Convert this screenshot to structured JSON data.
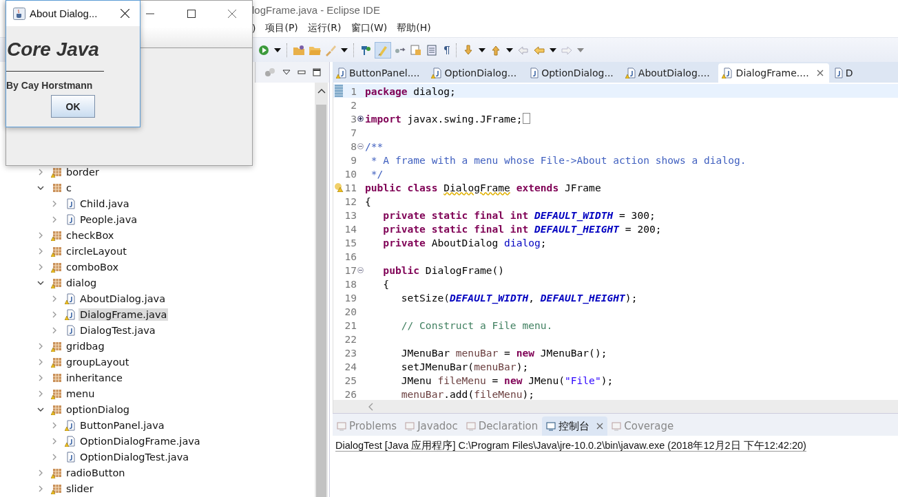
{
  "eclipse": {
    "title": "logFrame.java - Eclipse IDE",
    "menu": [
      {
        "label": ")"
      },
      {
        "label": "项目(P)"
      },
      {
        "label": "运行(R)"
      },
      {
        "label": "窗口(W)"
      },
      {
        "label": "帮助(H)"
      }
    ],
    "tree": [
      {
        "label": "border",
        "kind": "package",
        "warning": true,
        "expanded": false,
        "selected": false
      },
      {
        "label": "c",
        "kind": "package",
        "warning": false,
        "expanded": true,
        "selected": false,
        "children": [
          {
            "label": "Child.java",
            "kind": "file",
            "warning": false,
            "expanded": false,
            "selected": false
          },
          {
            "label": "People.java",
            "kind": "file",
            "warning": false,
            "expanded": false,
            "selected": false
          }
        ]
      },
      {
        "label": "checkBox",
        "kind": "package",
        "warning": true,
        "expanded": false,
        "selected": false
      },
      {
        "label": "circleLayout",
        "kind": "package",
        "warning": true,
        "expanded": false,
        "selected": false
      },
      {
        "label": "comboBox",
        "kind": "package",
        "warning": true,
        "expanded": false,
        "selected": false
      },
      {
        "label": "dialog",
        "kind": "package",
        "warning": true,
        "expanded": true,
        "selected": false,
        "children": [
          {
            "label": "AboutDialog.java",
            "kind": "file",
            "warning": true,
            "expanded": false,
            "selected": false
          },
          {
            "label": "DialogFrame.java",
            "kind": "file",
            "warning": true,
            "expanded": false,
            "selected": true
          },
          {
            "label": "DialogTest.java",
            "kind": "file",
            "warning": false,
            "expanded": false,
            "selected": false
          }
        ]
      },
      {
        "label": "gridbag",
        "kind": "package",
        "warning": true,
        "expanded": false,
        "selected": false
      },
      {
        "label": "groupLayout",
        "kind": "package",
        "warning": true,
        "expanded": false,
        "selected": false
      },
      {
        "label": "inheritance",
        "kind": "package",
        "warning": false,
        "expanded": false,
        "selected": false
      },
      {
        "label": "menu",
        "kind": "package",
        "warning": true,
        "expanded": false,
        "selected": false
      },
      {
        "label": "optionDialog",
        "kind": "package",
        "warning": true,
        "expanded": true,
        "selected": false,
        "children": [
          {
            "label": "ButtonPanel.java",
            "kind": "file",
            "warning": true,
            "expanded": false,
            "selected": false
          },
          {
            "label": "OptionDialogFrame.java",
            "kind": "file",
            "warning": true,
            "expanded": false,
            "selected": false
          },
          {
            "label": "OptionDialogTest.java",
            "kind": "file",
            "warning": false,
            "expanded": false,
            "selected": false
          }
        ]
      },
      {
        "label": "radioButton",
        "kind": "package",
        "warning": true,
        "expanded": false,
        "selected": false
      },
      {
        "label": "slider",
        "kind": "package",
        "warning": true,
        "expanded": false,
        "selected": false
      }
    ],
    "editor_tabs": [
      {
        "label": "ButtonPanel....",
        "warning": true,
        "selected": false
      },
      {
        "label": "OptionDialog...",
        "warning": true,
        "selected": false
      },
      {
        "label": "OptionDialog...",
        "warning": false,
        "selected": false
      },
      {
        "label": "AboutDialog....",
        "warning": true,
        "selected": false
      },
      {
        "label": "DialogFrame....",
        "warning": true,
        "selected": true
      },
      {
        "label": "D",
        "warning": false,
        "selected": false
      }
    ],
    "code": [
      {
        "num": "1",
        "current": true,
        "marker": {
          "kind": "bookmark"
        },
        "tokens": [
          {
            "text": "package",
            "kind": "keyword"
          },
          {
            "text": " dialog;",
            "kind": "plain"
          }
        ]
      },
      {
        "num": "2",
        "current": false
      },
      {
        "num": "3",
        "current": false,
        "fold": {
          "kind": "expand"
        },
        "folded": true,
        "tokens": [
          {
            "text": "import",
            "kind": "keyword"
          },
          {
            "text": " javax.swing.JFrame;",
            "kind": "plain"
          }
        ]
      },
      {
        "num": "7",
        "current": false
      },
      {
        "num": "8",
        "current": false,
        "fold": {
          "kind": "collapse"
        },
        "tokens": [
          {
            "text": "/**",
            "kind": "doc"
          }
        ]
      },
      {
        "num": "9",
        "current": false,
        "tokens": [
          {
            "text": " * A frame with a menu whose File->About action shows a dialog.",
            "kind": "doc"
          }
        ]
      },
      {
        "num": "10",
        "current": false,
        "tokens": [
          {
            "text": " */",
            "kind": "doc"
          }
        ]
      },
      {
        "num": "11",
        "current": false,
        "marker": {
          "kind": "warning"
        },
        "tokens": [
          {
            "text": "public class ",
            "kind": "keyword"
          },
          {
            "text": "DialogFrame",
            "kind": "warn"
          },
          {
            "text": " extends",
            "kind": "keyword"
          },
          {
            "text": " JFrame",
            "kind": "plain"
          }
        ]
      },
      {
        "num": "12",
        "current": false,
        "tokens": [
          {
            "text": "{",
            "kind": "plain"
          }
        ]
      },
      {
        "num": "13",
        "current": false,
        "tokens": [
          {
            "text": "   private static final int ",
            "kind": "keyword"
          },
          {
            "text": "DEFAULT_WIDTH",
            "kind": "constant"
          },
          {
            "text": " = 300;",
            "kind": "plain"
          }
        ]
      },
      {
        "num": "14",
        "current": false,
        "tokens": [
          {
            "text": "   private static final int ",
            "kind": "keyword"
          },
          {
            "text": "DEFAULT_HEIGHT",
            "kind": "constant"
          },
          {
            "text": " = 200;",
            "kind": "plain"
          }
        ]
      },
      {
        "num": "15",
        "current": false,
        "tokens": [
          {
            "text": "   private",
            "kind": "keyword"
          },
          {
            "text": " AboutDialog ",
            "kind": "plain"
          },
          {
            "text": "dialog",
            "kind": "field"
          },
          {
            "text": ";",
            "kind": "plain"
          }
        ]
      },
      {
        "num": "16",
        "current": false
      },
      {
        "num": "17",
        "current": false,
        "fold": {
          "kind": "collapse"
        },
        "tokens": [
          {
            "text": "   public",
            "kind": "keyword"
          },
          {
            "text": " DialogFrame()",
            "kind": "plain"
          }
        ]
      },
      {
        "num": "18",
        "current": false,
        "tokens": [
          {
            "text": "   {",
            "kind": "plain"
          }
        ]
      },
      {
        "num": "19",
        "current": false,
        "tokens": [
          {
            "text": "      setSize(",
            "kind": "plain"
          },
          {
            "text": "DEFAULT_WIDTH",
            "kind": "constant"
          },
          {
            "text": ", ",
            "kind": "plain"
          },
          {
            "text": "DEFAULT_HEIGHT",
            "kind": "constant"
          },
          {
            "text": ");",
            "kind": "plain"
          }
        ]
      },
      {
        "num": "20",
        "current": false
      },
      {
        "num": "21",
        "current": false,
        "tokens": [
          {
            "text": "      // Construct a File menu.",
            "kind": "comment"
          }
        ]
      },
      {
        "num": "22",
        "current": false
      },
      {
        "num": "23",
        "current": false,
        "tokens": [
          {
            "text": "      JMenuBar ",
            "kind": "plain"
          },
          {
            "text": "menuBar",
            "kind": "local"
          },
          {
            "text": " = ",
            "kind": "plain"
          },
          {
            "text": "new",
            "kind": "keyword"
          },
          {
            "text": " JMenuBar();",
            "kind": "plain"
          }
        ]
      },
      {
        "num": "24",
        "current": false,
        "tokens": [
          {
            "text": "      setJMenuBar(",
            "kind": "plain"
          },
          {
            "text": "menuBar",
            "kind": "local"
          },
          {
            "text": ");",
            "kind": "plain"
          }
        ]
      },
      {
        "num": "25",
        "current": false,
        "tokens": [
          {
            "text": "      JMenu ",
            "kind": "plain"
          },
          {
            "text": "fileMenu",
            "kind": "local"
          },
          {
            "text": " = ",
            "kind": "plain"
          },
          {
            "text": "new",
            "kind": "keyword"
          },
          {
            "text": " JMenu(",
            "kind": "plain"
          },
          {
            "text": "\"File\"",
            "kind": "string"
          },
          {
            "text": ");",
            "kind": "plain"
          }
        ]
      },
      {
        "num": "26",
        "current": false,
        "tokens": [
          {
            "text": "      menuBar",
            "kind": "local"
          },
          {
            "text": ".add(",
            "kind": "plain"
          },
          {
            "text": "fileMenu",
            "kind": "local"
          },
          {
            "text": ");",
            "kind": "plain"
          }
        ]
      }
    ],
    "bottom_tabs": [
      {
        "label": "Problems",
        "selected": false
      },
      {
        "label": "Javadoc",
        "selected": false
      },
      {
        "label": "Declaration",
        "selected": false
      },
      {
        "label": "控制台",
        "selected": true
      },
      {
        "label": "Coverage",
        "selected": false
      }
    ],
    "console": "DialogTest [Java 应用程序] C:\\Program Files\\Java\\jre-10.0.2\\bin\\javaw.exe  (2018年12月2日 下午12:42:20)"
  },
  "about_dialog": {
    "title": "About Dialog...",
    "heading": "Core Java",
    "byline": "By Cay Horstmann",
    "button": "OK"
  }
}
